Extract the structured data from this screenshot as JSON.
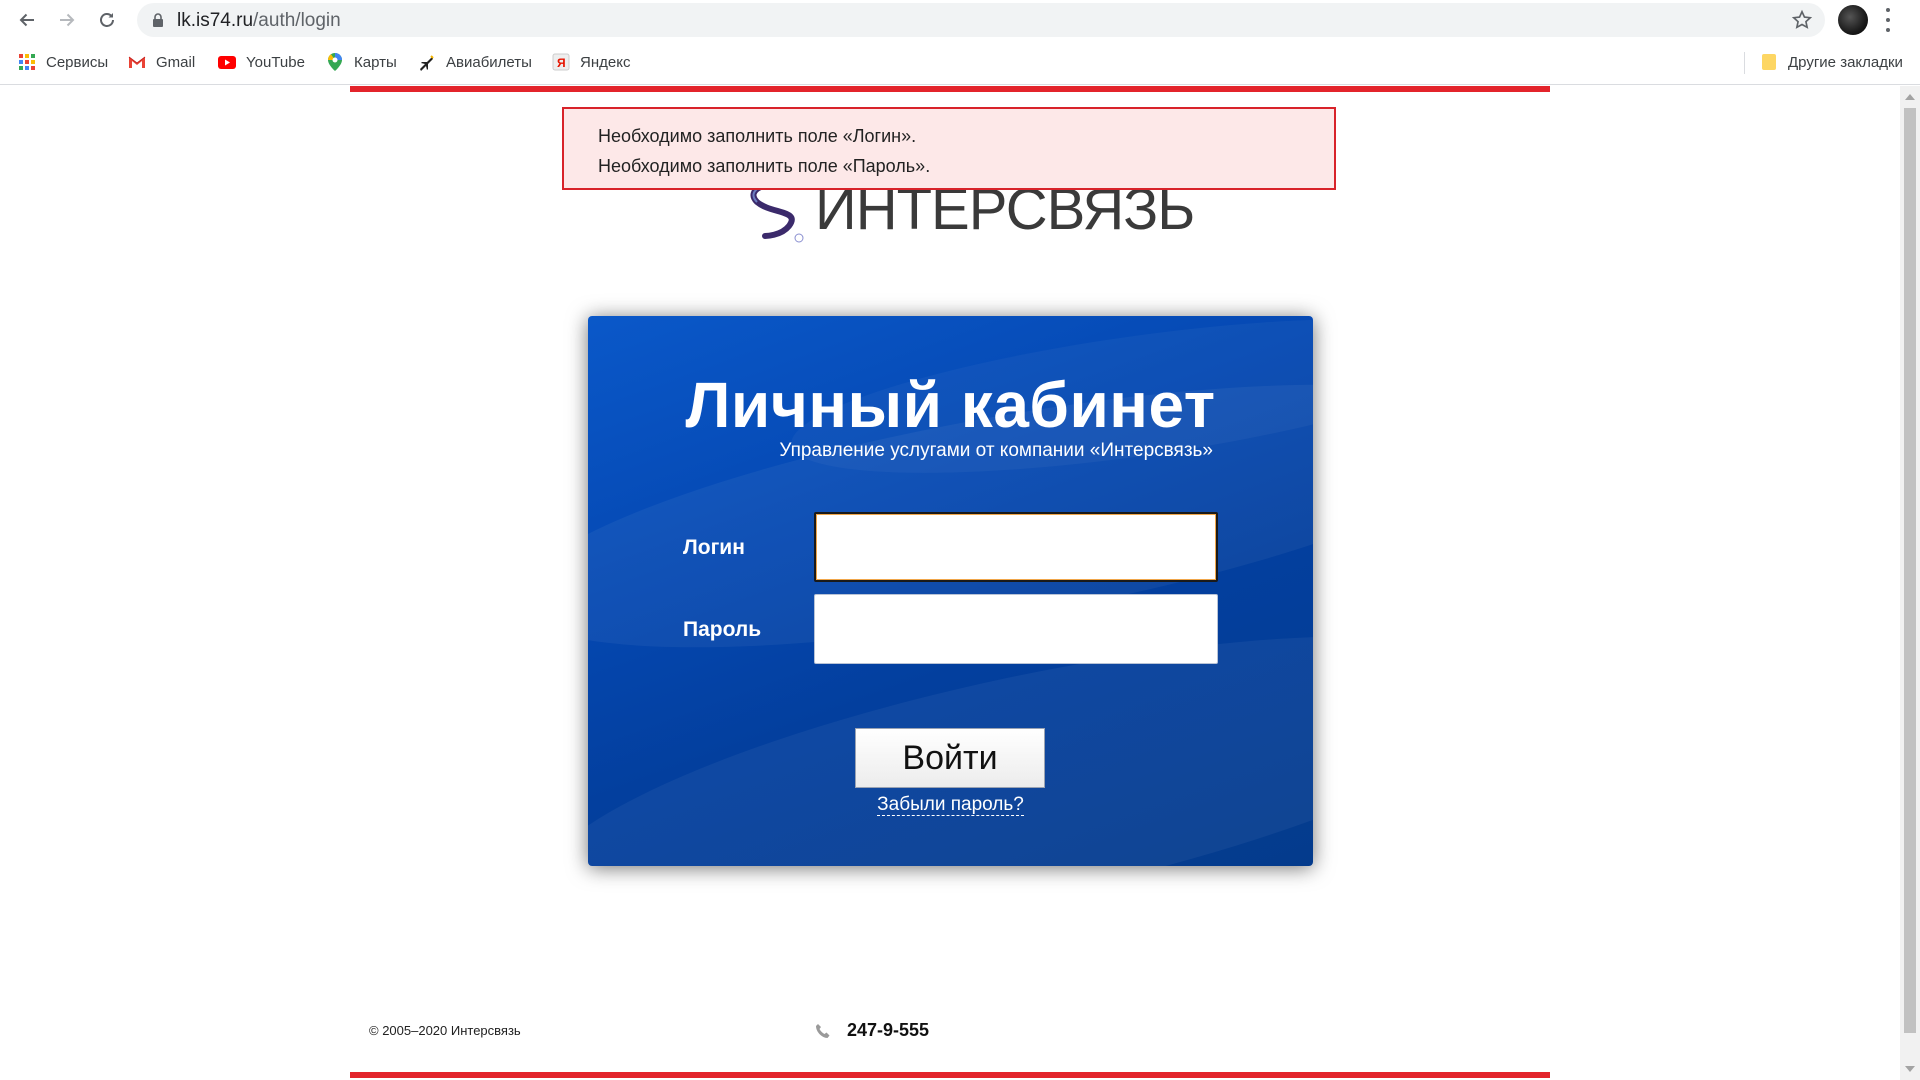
{
  "browser": {
    "url_host": "lk.is74.ru",
    "url_path": "/auth/login"
  },
  "bookmarks": [
    {
      "label": "Сервисы",
      "icon": "apps-grid-icon"
    },
    {
      "label": "Gmail",
      "icon": "gmail-icon"
    },
    {
      "label": "YouTube",
      "icon": "youtube-icon"
    },
    {
      "label": "Карты",
      "icon": "maps-pin-icon"
    },
    {
      "label": "Авиабилеты",
      "icon": "airplane-icon"
    },
    {
      "label": "Яндекс",
      "icon": "yandex-icon"
    }
  ],
  "other_bookmarks": "Другие закладки",
  "errors": [
    "Необходимо заполнить поле «Логин».",
    "Необходимо заполнить поле «Пароль»."
  ],
  "logo": {
    "wordmark": "ИНТЕРСВЯЗЬ"
  },
  "login": {
    "title": "Личный кабинет",
    "subtitle": "Управление услугами от компании «Интерсвязь»",
    "login_label": "Логин",
    "login_value": "",
    "password_label": "Пароль",
    "password_value": "",
    "submit_label": "Войти",
    "forgot_label": "Забыли пароль?"
  },
  "footer": {
    "copyright": "© 2005–2020 Интерсвязь",
    "phone": "247-9-555"
  },
  "colors": {
    "accent_red": "#e3242b",
    "panel_blue": "#0548b2"
  }
}
